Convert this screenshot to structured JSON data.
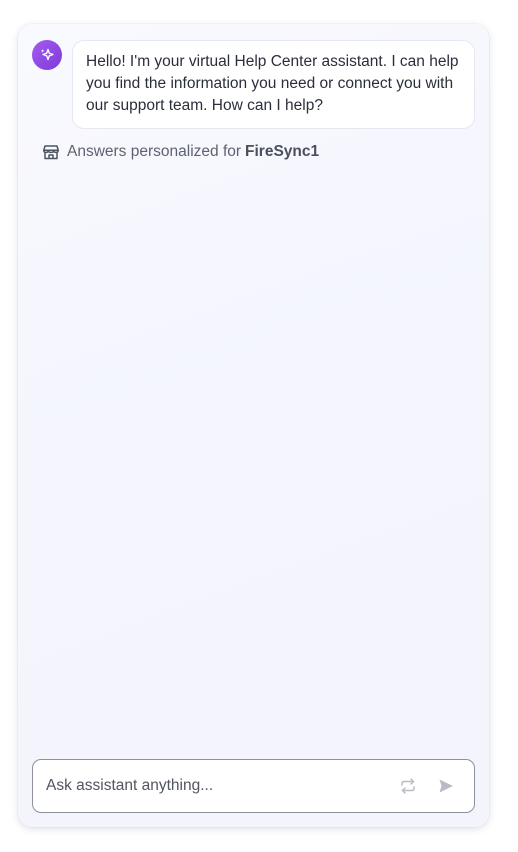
{
  "chat": {
    "assistant_message": "Hello! I'm your virtual Help Center assistant. I can help you find the information you need or connect you with our support team. How can I help?",
    "personalized_prefix": "Answers personalized for",
    "workspace_name": "FireSync1"
  },
  "composer": {
    "placeholder": "Ask assistant anything...",
    "value": ""
  },
  "icons": {
    "avatar": "sparkle-icon",
    "personalized": "store-icon",
    "refresh": "refresh-icon",
    "send": "send-icon"
  },
  "colors": {
    "accent": "#8b46e3",
    "panel_background": "#f5f6fd",
    "bubble_background": "#ffffff",
    "text_primary": "#2b2f3b",
    "text_secondary": "#5c6270",
    "icon_muted": "#b9bcc4"
  }
}
